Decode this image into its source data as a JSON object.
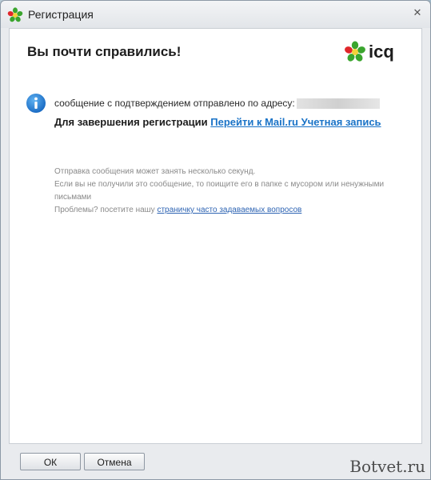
{
  "window": {
    "title": "Регистрация",
    "close_icon": "close-icon"
  },
  "main": {
    "heading": "Вы почти справились!",
    "brand": "icq",
    "info_icon": "info-icon",
    "sent_message": "сообщение с подтверждением отправлено по адресу:",
    "complete_prefix": "Для завершения регистрации ",
    "complete_link": "Перейти к Mail.ru Учетная запись",
    "notes": {
      "line1": "Отправка сообщения может занять несколько секунд.",
      "line2": "Если вы не получили это сообщение, то поищите его в папке с мусором или ненужными письмами",
      "line3_prefix": "Проблемы? посетите нашу ",
      "line3_link": "страничку часто задаваемых вопросов"
    }
  },
  "footer": {
    "ok_label": "ОК",
    "cancel_label": "Отмена",
    "watermark": "Botvet.ru"
  },
  "colors": {
    "link": "#1a73c7",
    "info_blue": "#1e7fd6",
    "icq_green": "#3aa52e",
    "icq_red": "#e0262a"
  }
}
